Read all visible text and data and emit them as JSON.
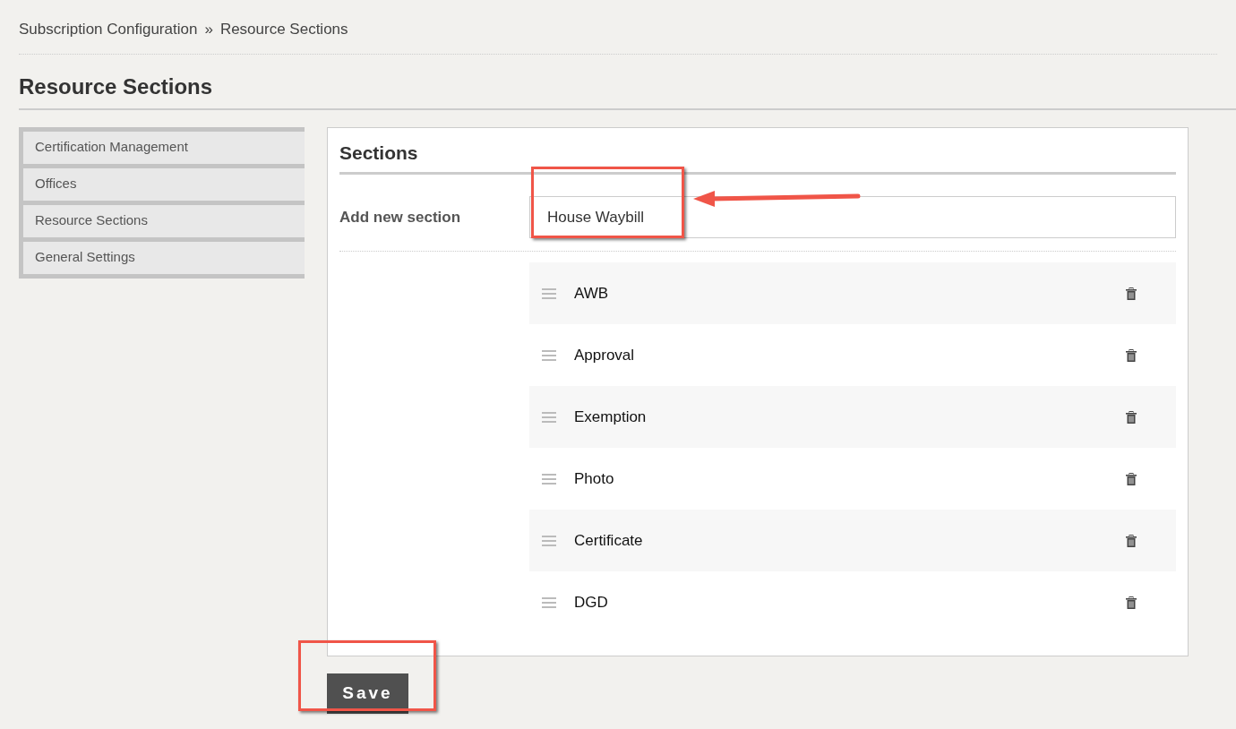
{
  "breadcrumb": {
    "items": [
      "Subscription Configuration",
      "Resource Sections"
    ],
    "separator": "»"
  },
  "page_title": "Resource Sections",
  "sidebar": {
    "items": [
      {
        "label": "Certification Management"
      },
      {
        "label": "Offices"
      },
      {
        "label": "Resource Sections"
      },
      {
        "label": "General Settings"
      }
    ]
  },
  "panel": {
    "title": "Sections",
    "add_label": "Add new section",
    "add_value": "House Waybill",
    "sections": [
      {
        "name": "AWB"
      },
      {
        "name": "Approval"
      },
      {
        "name": "Exemption"
      },
      {
        "name": "Photo"
      },
      {
        "name": "Certificate"
      },
      {
        "name": "DGD"
      }
    ]
  },
  "save_button": "Save"
}
